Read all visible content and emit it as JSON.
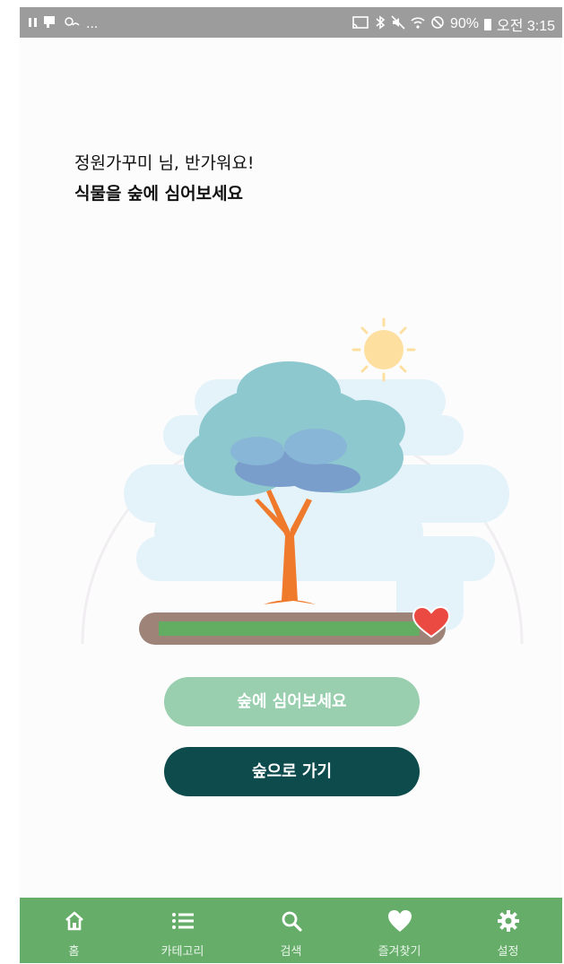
{
  "status_bar": {
    "left_text": "...",
    "battery": "90%",
    "time": "오전 3:15"
  },
  "main": {
    "greeting": "정원가꾸미 님, 반가워요!",
    "subtitle": "식물을 숲에 심어보세요"
  },
  "progress": {
    "fill_fraction": 0.95
  },
  "buttons": {
    "plant_label": "숲에 심어보세요",
    "forest_label": "숲으로 가기"
  },
  "nav": {
    "items": [
      {
        "label": "홈",
        "icon": "home-icon"
      },
      {
        "label": "카테고리",
        "icon": "list-icon"
      },
      {
        "label": "검색",
        "icon": "search-icon"
      },
      {
        "label": "즐겨찾기",
        "icon": "heart-icon"
      },
      {
        "label": "설정",
        "icon": "gear-icon"
      }
    ]
  },
  "colors": {
    "nav_bg": "#66ad69",
    "plant_button": "#99cfae",
    "forest_button": "#0e4b4d",
    "status_bar": "#9c9c9c"
  }
}
